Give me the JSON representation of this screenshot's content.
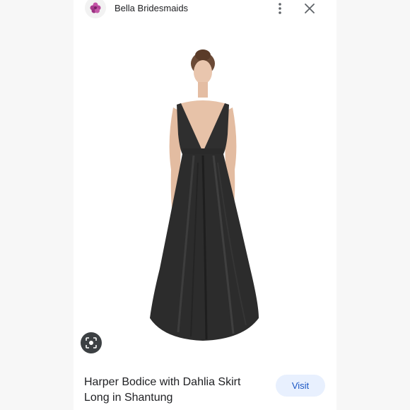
{
  "header": {
    "site_name": "Bella Bridesmaids",
    "logo_icon": "flower-logo-icon",
    "more_icon": "more-vert-icon",
    "close_icon": "close-icon"
  },
  "product": {
    "title": "Harper Bodice with Dahlia Skirt Long in Shantung",
    "image_alt": "Model wearing long black v-neck gown"
  },
  "actions": {
    "visit_label": "Visit",
    "lens_icon": "lens-search-icon"
  },
  "colors": {
    "accent": "#1a56c4",
    "visit_bg": "#e8f0fe",
    "dress": "#2a2a2a",
    "logo": "#b5449a"
  }
}
